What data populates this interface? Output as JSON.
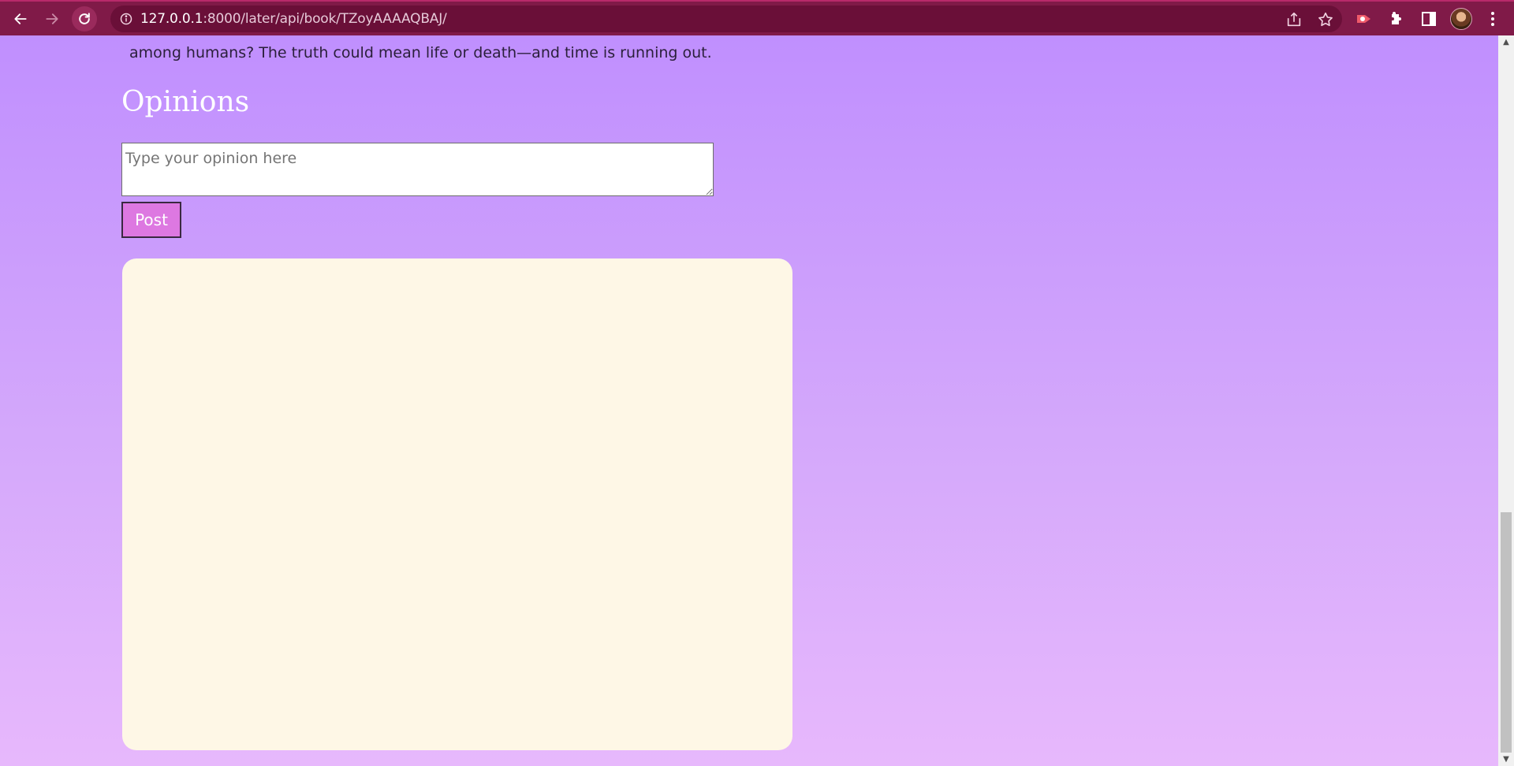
{
  "browser": {
    "url_host": "127.0.0.1",
    "url_path": ":8000/later/api/book/TZoyAAAAQBAJ/"
  },
  "page": {
    "summary_tail": "among humans? The truth could mean life or death—and time is running out.",
    "opinions_heading": "Opinions",
    "opinion_placeholder": "Type your opinion here",
    "post_label": "Post"
  },
  "colors": {
    "toolbar": "#801a48",
    "post_button": "#dd78e1",
    "panel": "#fef7e6",
    "page_gradient_top": "#c08ffe",
    "page_gradient_bottom": "#e7b8fc"
  },
  "icons": {
    "back": "arrow-left",
    "forward": "arrow-right",
    "reload": "refresh",
    "site_info": "info-circle",
    "share": "share",
    "bookmark": "star",
    "extension_red": "record",
    "extensions": "puzzle",
    "side_panel": "sidebar",
    "menu": "kebab"
  }
}
